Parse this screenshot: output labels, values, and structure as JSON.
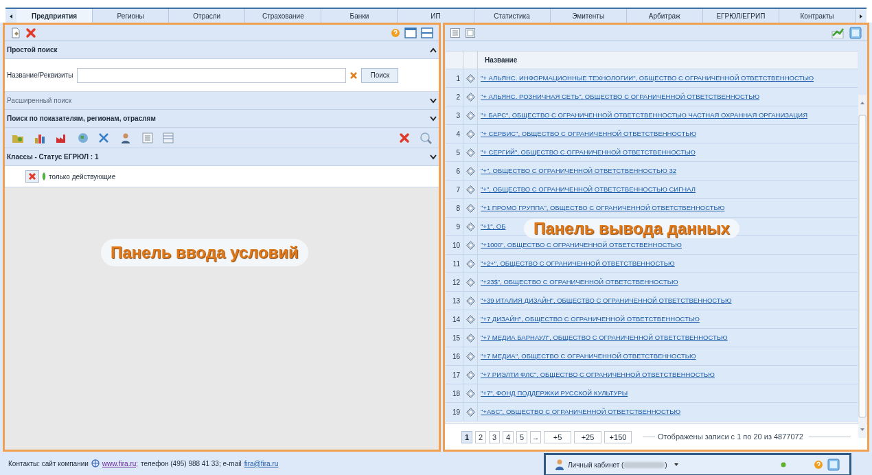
{
  "tabs": [
    {
      "label": "Предприятия",
      "selected": true
    },
    {
      "label": "Регионы",
      "selected": false
    },
    {
      "label": "Отрасли",
      "selected": false
    },
    {
      "label": "Страхование",
      "selected": false
    },
    {
      "label": "Банки",
      "selected": false
    },
    {
      "label": "ИП",
      "selected": false
    },
    {
      "label": "Статистика",
      "selected": false
    },
    {
      "label": "Эмитенты",
      "selected": false
    },
    {
      "label": "Арбитраж",
      "selected": false
    },
    {
      "label": "ЕГРЮЛ/ЕГРИП",
      "selected": false
    },
    {
      "label": "Контракты",
      "selected": false
    }
  ],
  "left_panel": {
    "sections": [
      {
        "title": "Простой поиск",
        "expanded": true,
        "muted": false
      },
      {
        "title": "Расширенный поиск",
        "expanded": false,
        "muted": true
      },
      {
        "title": "Поиск по показателям, регионам, отраслям",
        "expanded": false,
        "muted": false
      },
      {
        "title": "Классы - Статус ЕГРЮЛ : 1",
        "expanded": false,
        "muted": false
      }
    ],
    "search": {
      "label": "Название/Реквизиты",
      "button": "Поиск"
    },
    "filters": [
      {
        "label": "только действующие"
      }
    ],
    "overlay": "Панель ввода условий"
  },
  "right_panel": {
    "table": {
      "columns": [
        "Название"
      ],
      "rows": [
        {
          "num": "1",
          "name": "\"+ АЛЬЯНС. ИНФОРМАЦИОННЫЕ ТЕХНОЛОГИИ\", ОБЩЕСТВО С ОГРАНИЧЕННОЙ ОТВЕТСТВЕННОСТЬЮ"
        },
        {
          "num": "2",
          "name": "\"+ АЛЬЯНС. РОЗНИЧНАЯ СЕТЬ\", ОБЩЕСТВО С ОГРАНИЧЕННОЙ ОТВЕТСТВЕННОСТЬЮ"
        },
        {
          "num": "3",
          "name": "\"+ БАРС\", ОБЩЕСТВО С ОГРАНИЧЕННОЙ ОТВЕТСТВЕННОСТЬЮ ЧАСТНАЯ ОХРАННАЯ ОРГАНИЗАЦИЯ"
        },
        {
          "num": "4",
          "name": "\"+ СЕРВИС\", ОБЩЕСТВО С ОГРАНИЧЕННОЙ ОТВЕТСТВЕННОСТЬЮ"
        },
        {
          "num": "5",
          "name": "\"+ СЕРГИЙ\", ОБЩЕСТВО С ОГРАНИЧЕННОЙ ОТВЕТСТВЕННОСТЬЮ"
        },
        {
          "num": "6",
          "name": "\"+\", ОБЩЕСТВО С ОГРАНИЧЕННОЙ ОТВЕТСТВЕННОСТЬЮ 32"
        },
        {
          "num": "7",
          "name": "\"+\", ОБЩЕСТВО С ОГРАНИЧЕННОЙ ОТВЕТСТВЕННОСТЬЮ СИГНАЛ"
        },
        {
          "num": "8",
          "name": "\"+1 ПРОМО ГРУППА\", ОБЩЕСТВО С ОГРАНИЧЕННОЙ ОТВЕТСТВЕННОСТЬЮ"
        },
        {
          "num": "9",
          "name": "\"+1\", ОБ"
        },
        {
          "num": "10",
          "name": "\"+1000\", ОБЩЕСТВО С ОГРАНИЧЕННОЙ ОТВЕТСТВЕННОСТЬЮ"
        },
        {
          "num": "11",
          "name": "\"+2+\", ОБЩЕСТВО С ОГРАНИЧЕННОЙ ОТВЕТСТВЕННОСТЬЮ"
        },
        {
          "num": "12",
          "name": "\"+23$\", ОБЩЕСТВО С ОГРАНИЧЕННОЙ ОТВЕТСТВЕННОСТЬЮ"
        },
        {
          "num": "13",
          "name": "\"+39 ИТАЛИЯ ДИЗАЙН\", ОБЩЕСТВО С ОГРАНИЧЕННОЙ ОТВЕТСТВЕННОСТЬЮ"
        },
        {
          "num": "14",
          "name": "\"+7 ДИЗАЙН\", ОБЩЕСТВО С ОГРАНИЧЕННОЙ ОТВЕТСТВЕННОСТЬЮ"
        },
        {
          "num": "15",
          "name": "\"+7 МЕДИА БАРНАУЛ\", ОБЩЕСТВО С ОГРАНИЧЕННОЙ ОТВЕТСТВЕННОСТЬЮ"
        },
        {
          "num": "16",
          "name": "\"+7 МЕДИА\", ОБЩЕСТВО С ОГРАНИЧЕННОЙ ОТВЕТСТВЕННОСТЬЮ"
        },
        {
          "num": "17",
          "name": "\"+7 РИЭЛТИ ФЛС\", ОБЩЕСТВО С ОГРАНИЧЕННОЙ ОТВЕТСТВЕННОСТЬЮ"
        },
        {
          "num": "18",
          "name": "\"+7\", ФОНД ПОДДЕРЖКИ РУССКОЙ КУЛЬТУРЫ"
        },
        {
          "num": "19",
          "name": "\"+АБС\", ОБЩЕСТВО С ОГРАНИЧЕННОЙ ОТВЕТСТВЕННОСТЬЮ"
        }
      ]
    },
    "pager": {
      "pages": [
        {
          "label": "1",
          "selected": true
        },
        {
          "label": "2",
          "selected": false
        },
        {
          "label": "3",
          "selected": false
        },
        {
          "label": "4",
          "selected": false
        },
        {
          "label": "5",
          "selected": false
        }
      ],
      "next": "→",
      "jumps": [
        "+5",
        "+25",
        "+150"
      ],
      "info": "Отображены записи с 1 по 20 из 4877072"
    },
    "overlay": "Панель вывода данных"
  },
  "footer": {
    "prefix": "Контакты: сайт компании",
    "site": "www.fira.ru;",
    "middle": "телефон (495) 988 41 33; e-mail",
    "email": "fira@fira.ru"
  },
  "account": {
    "label": "Личный кабинет (",
    "suffix": ")"
  }
}
